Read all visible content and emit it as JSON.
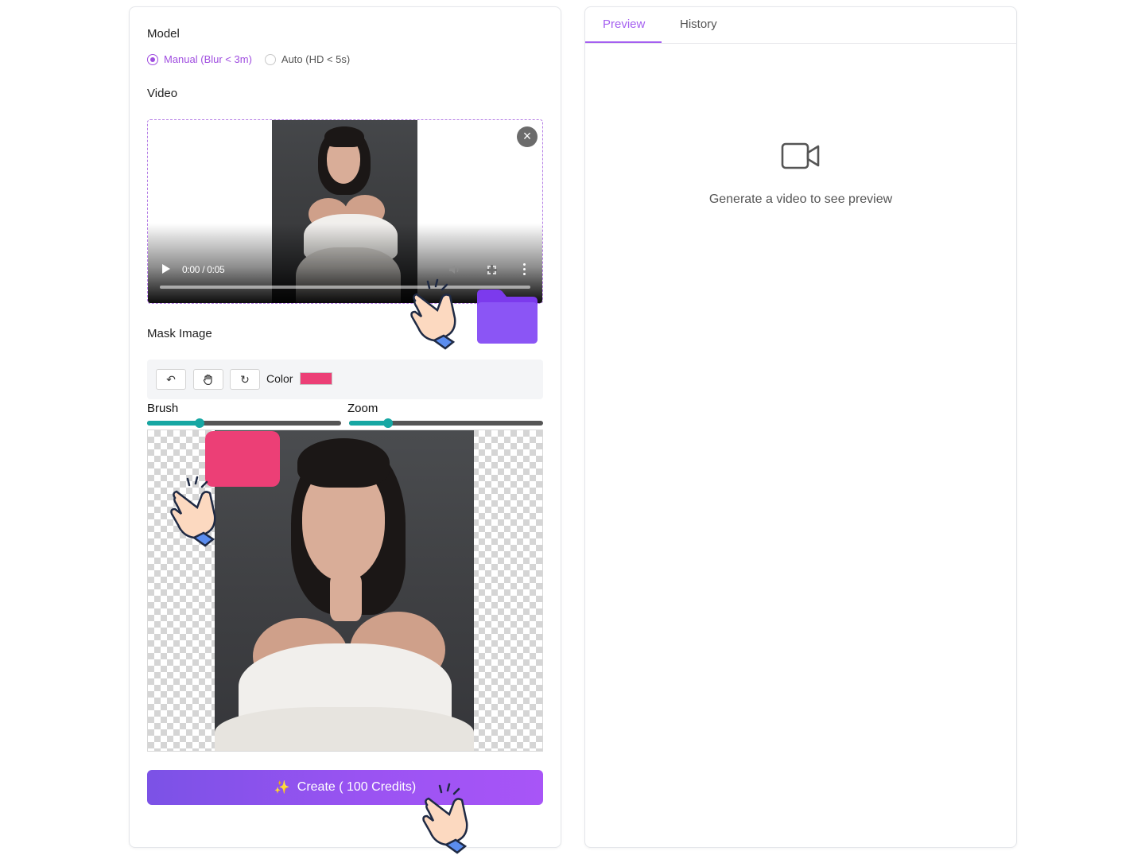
{
  "model": {
    "label": "Model",
    "options": [
      {
        "label": "Manual (Blur < 3m)",
        "selected": true
      },
      {
        "label": "Auto (HD < 5s)",
        "selected": false
      }
    ]
  },
  "video": {
    "label": "Video",
    "time": "0:00 / 0:05",
    "progress": 0
  },
  "mask": {
    "label": "Mask Image",
    "color_label": "Color",
    "color_value": "#ec3f76",
    "brush_label": "Brush",
    "zoom_label": "Zoom",
    "brush_level": 0.27,
    "zoom_level": 0.2
  },
  "create_button": {
    "label": "Create ( 100 Credits)"
  },
  "tabs": [
    {
      "label": "Preview",
      "active": true
    },
    {
      "label": "History",
      "active": false
    }
  ],
  "preview": {
    "empty_text": "Generate a video to see preview"
  },
  "colors": {
    "accent": "#a04ee0",
    "brush": "#ec3f76",
    "slider": "#16a7a3",
    "button_gradient_start": "#7b52e6",
    "button_gradient_end": "#a855f7",
    "folder": "#8b55f5"
  }
}
